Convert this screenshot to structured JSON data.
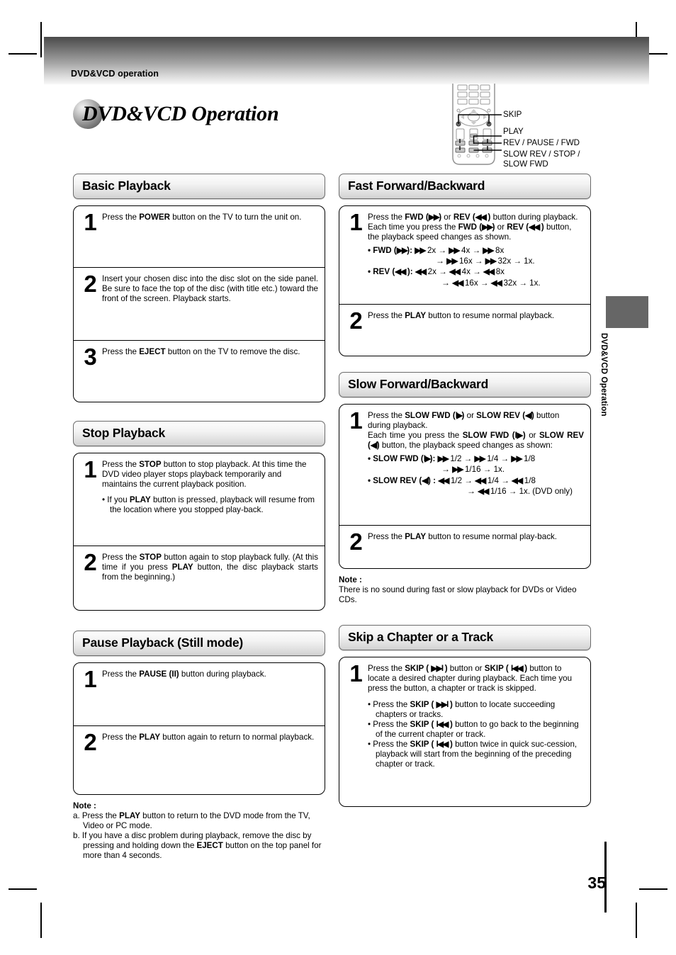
{
  "header": {
    "running_head": "DVD&VCD operation"
  },
  "title": {
    "text": "DVD&VCD Operation"
  },
  "remote": {
    "callouts": [
      {
        "label": "SKIP"
      },
      {
        "label": "PLAY"
      },
      {
        "label": "REV / PAUSE / FWD"
      },
      {
        "label": "SLOW REV / STOP /"
      },
      {
        "label": "SLOW FWD"
      }
    ]
  },
  "side_tab": {
    "label": "DVD&VCD Operation",
    "color": "#666666"
  },
  "footer": {
    "page_number": "35"
  },
  "sections": {
    "basic_playback": {
      "heading": "Basic Playback",
      "steps": [
        {
          "num": "1",
          "text": "Press the POWER button on the TV to turn the unit on.",
          "pre": "Press the ",
          "bold": "POWER",
          "post": " button on the TV to turn the unit on."
        },
        {
          "num": "2",
          "pre": "Insert your chosen disc into the disc slot on the side panel. Be sure to face the top of the disc (with title etc.) toward the front of the screen. Playback starts."
        },
        {
          "num": "3",
          "pre": "Press the ",
          "bold": "EJECT",
          "post": " button on the TV to remove the disc."
        }
      ]
    },
    "stop_playback": {
      "heading": "Stop Playback",
      "step1_pre": "Press the ",
      "step1_b1": "STOP",
      "step1_mid": " button to stop playback. At this time the DVD video player stops playback temporarily and maintains the current playback position.",
      "step1_bullet_pre": "• If you ",
      "step1_bullet_b": "PLAY",
      "step1_bullet_post": " button is pressed, playback will resume from the location where you stopped play-back.",
      "step2_pre": "Press the ",
      "step2_b1": "STOP",
      "step2_mid": " button again to stop playback fully. (At this time if you press ",
      "step2_b2": "PLAY",
      "step2_post": " button, the disc playback starts from the beginning.)",
      "num1": "1",
      "num2": "2"
    },
    "pause_playback": {
      "heading": "Pause Playback (Still mode)",
      "num1": "1",
      "num2": "2",
      "step1_pre": "Press the ",
      "step1_b": "PAUSE (II)",
      "step1_post": " button during playback.",
      "step2_pre": "Press the ",
      "step2_b": "PLAY",
      "step2_post": " button again to return to normal playback."
    },
    "left_note": {
      "heading": "Note :",
      "a_pre": "a. Press the ",
      "a_b": "PLAY",
      "a_post": " button to return to the DVD mode from the TV, Video or PC mode.",
      "b_pre": "b. If you have a disc problem during playback, remove the disc by pressing and holding down the ",
      "b_b": "EJECT",
      "b_post": " button on the top panel for more than 4 seconds."
    },
    "fast_fwd_back": {
      "heading": "Fast Forward/Backward",
      "num1": "1",
      "num2": "2",
      "l1_a": "Press the ",
      "l1_fwd": "FWD (",
      "l1_fwd_sym": "▶▶",
      "l1_fwd_close": ")",
      "l1_or": "  or  ",
      "l1_rev": "REV (",
      "l1_rev_sym": "◀◀",
      "l1_rev_close": " )",
      "l1_end": " button during playback.",
      "l2_a": "Each time you press the ",
      "l2_end": " button, the playback speed changes as shown.",
      "fwd_label": "• FWD (",
      "fwd_label_end": "):",
      "fwd_seq1": "2x →",
      "fwd_seq2": "4x →",
      "fwd_seq3": "8x",
      "fwd_seq4": "→",
      "fwd_seq5": "16x →",
      "fwd_seq6": "32x → 1x.",
      "rev_label": "• REV (",
      "rev_label_end": " ):",
      "rev_seq1": "2x →",
      "rev_seq2": "4x →",
      "rev_seq3": "8x",
      "rev_seq4": "→",
      "rev_seq5": "16x →",
      "rev_seq6": "32x → 1x.",
      "step2_pre": "Press the ",
      "step2_b": "PLAY",
      "step2_post": " button to resume normal playback."
    },
    "slow_fwd_back": {
      "heading": "Slow Forward/Backward",
      "num1": "1",
      "num2": "2",
      "l1_a": "Press the ",
      "sfwd": "SLOW FWD (",
      "sfwd_sym": "I▶",
      "sfwd_close": ")",
      "l1_or": " or ",
      "srev": "SLOW REV (",
      "srev_sym": "◀I",
      "srev_close": ")",
      "l1_end": " button during playback.",
      "l2_a": "Each time you press the ",
      "l2_or": "  or",
      "l2_end": " button, the playback speed changes as shown:",
      "sfwd_label": "• SLOW FWD (",
      "sfwd_label_end": "):",
      "sfwd_seq1": "1/2 →",
      "sfwd_seq2": "1/4 →",
      "sfwd_seq3": "1/8",
      "sfwd_seq4": "→",
      "sfwd_seq5": "1/16 → 1x.",
      "srev_label": "• SLOW REV  (",
      "srev_label_end": ") :",
      "srev_seq1": "1/2 →",
      "srev_seq2": "1/4 →",
      "srev_seq3": "1/8",
      "srev_seq4": "→",
      "srev_seq5": "1/16 → 1x. (DVD only)",
      "step2_pre": "Press the ",
      "step2_b": "PLAY",
      "step2_post": " button to resume normal play-back."
    },
    "right_note": {
      "heading": "Note :",
      "text": "There is no sound during fast or slow playback for DVDs or Video CDs."
    },
    "skip_chapter": {
      "heading": "Skip a Chapter or a Track",
      "num1": "1",
      "l1_a": "Press the ",
      "skip_f": "SKIP (",
      "skip_f_sym": "▶▶I",
      "skip_f_close": " )",
      "l1_mid": " button or ",
      "skip_b": "SKIP (",
      "skip_b_sym": "I◀◀",
      "skip_b_close": " )",
      "l1_end": " button to locate a desired chapter during playback. Each time you press the button, a chapter or track is skipped.",
      "b1_pre": "• Press the ",
      "b1_post": " button to locate succeeding chapters or tracks.",
      "b2_pre": "• Press the ",
      "b2_post": " button to go back to the beginning of the current chapter or track.",
      "b3_pre": "• Press the ",
      "b3_post": " button twice in quick suc-cession, playback will start from the beginning of the preceding chapter or track."
    }
  }
}
